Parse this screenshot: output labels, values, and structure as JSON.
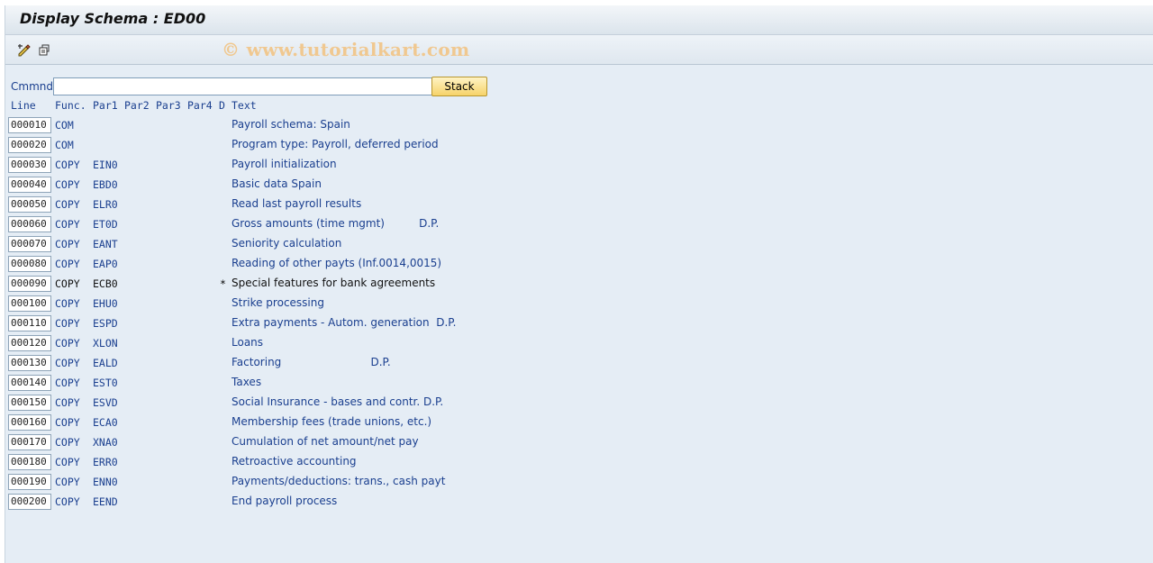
{
  "window": {
    "title": "Display Schema : ED00",
    "watermark": "© www.tutorialkart.com"
  },
  "toolbar": {
    "icons": [
      "display-change-icon",
      "other-object-icon"
    ]
  },
  "command": {
    "label": "Cmmnd",
    "value": "",
    "stack_label": "Stack"
  },
  "headers": {
    "line": "Line",
    "func": "Func.",
    "par1": "Par1",
    "par2": "Par2",
    "par3": "Par3",
    "par4": "Par4",
    "d": "D",
    "text": "Text"
  },
  "rows": [
    {
      "line": "000010",
      "func": "COM",
      "par1": "",
      "d": "",
      "text": "Payroll schema: Spain"
    },
    {
      "line": "000020",
      "func": "COM",
      "par1": "",
      "d": "",
      "text": "Program type: Payroll, deferred period"
    },
    {
      "line": "000030",
      "func": "COPY",
      "par1": "EIN0",
      "d": "",
      "text": "Payroll initialization"
    },
    {
      "line": "000040",
      "func": "COPY",
      "par1": "EBD0",
      "d": "",
      "text": "Basic data Spain"
    },
    {
      "line": "000050",
      "func": "COPY",
      "par1": "ELR0",
      "d": "",
      "text": "Read last payroll results"
    },
    {
      "line": "000060",
      "func": "COPY",
      "par1": "ET0D",
      "d": "",
      "text": "Gross amounts (time mgmt)          D.P."
    },
    {
      "line": "000070",
      "func": "COPY",
      "par1": "EANT",
      "d": "",
      "text": "Seniority calculation"
    },
    {
      "line": "000080",
      "func": "COPY",
      "par1": "EAP0",
      "d": "",
      "text": "Reading of other payts (Inf.0014,0015)"
    },
    {
      "line": "000090",
      "func": "COPY",
      "par1": "ECB0",
      "d": "*",
      "text": "Special features for bank agreements"
    },
    {
      "line": "000100",
      "func": "COPY",
      "par1": "EHU0",
      "d": "",
      "text": "Strike processing"
    },
    {
      "line": "000110",
      "func": "COPY",
      "par1": "ESPD",
      "d": "",
      "text": "Extra payments - Autom. generation  D.P."
    },
    {
      "line": "000120",
      "func": "COPY",
      "par1": "XLON",
      "d": "",
      "text": "Loans"
    },
    {
      "line": "000130",
      "func": "COPY",
      "par1": "EALD",
      "d": "",
      "text": "Factoring                          D.P."
    },
    {
      "line": "000140",
      "func": "COPY",
      "par1": "EST0",
      "d": "",
      "text": "Taxes"
    },
    {
      "line": "000150",
      "func": "COPY",
      "par1": "ESVD",
      "d": "",
      "text": "Social Insurance - bases and contr. D.P."
    },
    {
      "line": "000160",
      "func": "COPY",
      "par1": "ECA0",
      "d": "",
      "text": "Membership fees (trade unions, etc.)"
    },
    {
      "line": "000170",
      "func": "COPY",
      "par1": "XNA0",
      "d": "",
      "text": "Cumulation of net amount/net pay"
    },
    {
      "line": "000180",
      "func": "COPY",
      "par1": "ERR0",
      "d": "",
      "text": "Retroactive accounting"
    },
    {
      "line": "000190",
      "func": "COPY",
      "par1": "ENN0",
      "d": "",
      "text": "Payments/deductions: trans., cash payt"
    },
    {
      "line": "000200",
      "func": "COPY",
      "par1": "EEND",
      "d": "",
      "text": "End payroll process"
    }
  ]
}
